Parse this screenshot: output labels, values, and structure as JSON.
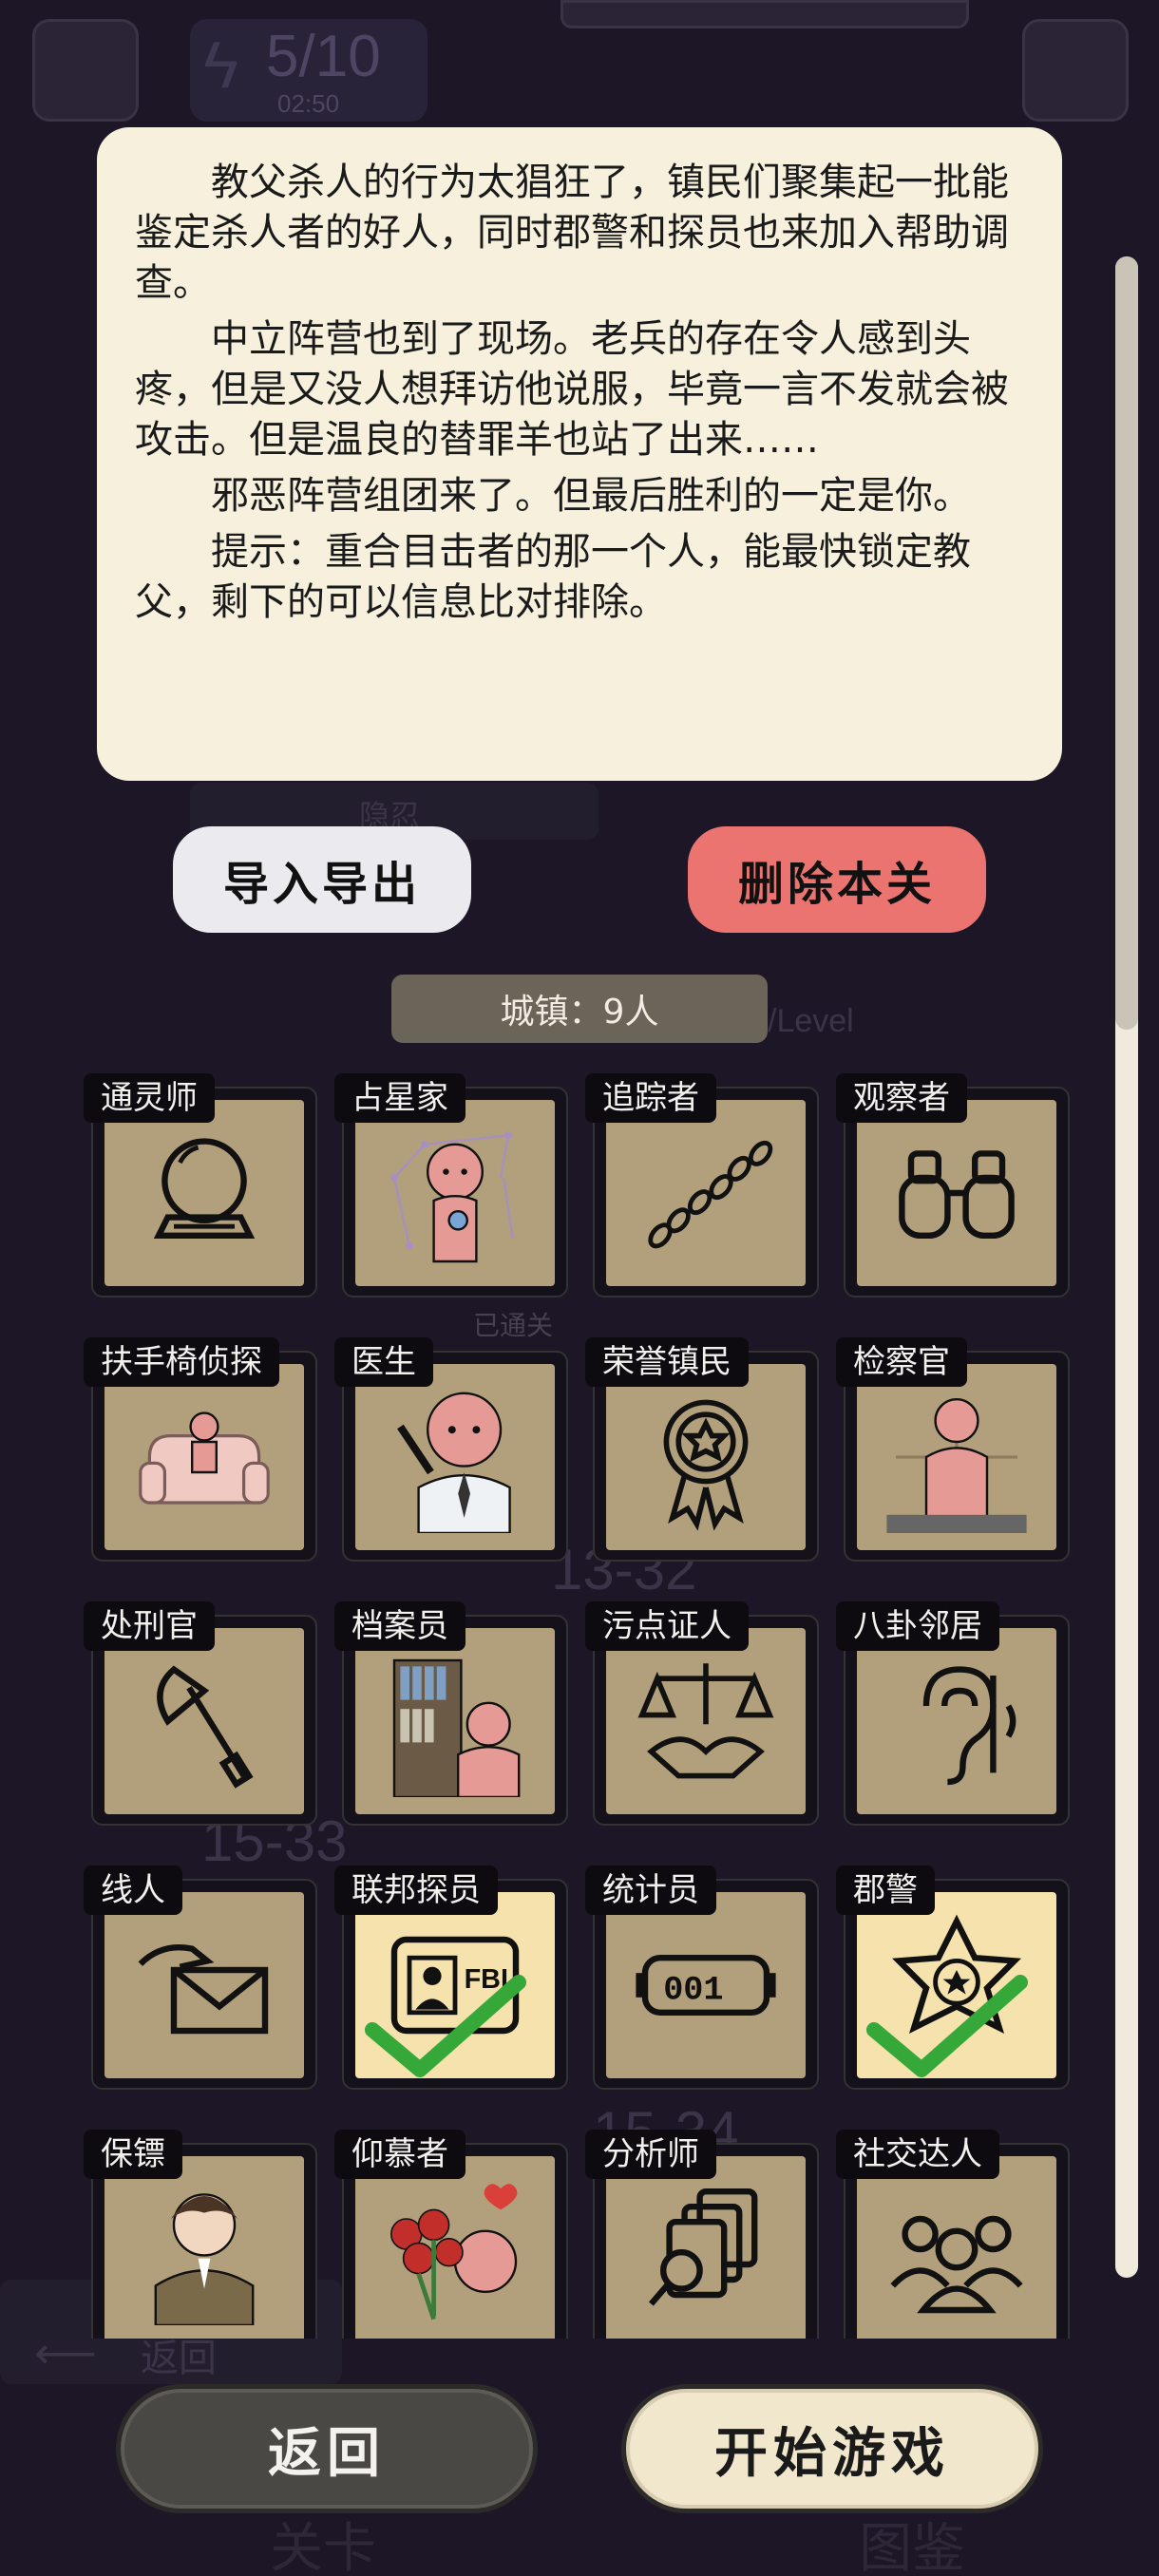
{
  "background": {
    "energy_value": "5/10",
    "energy_timer": "02:50",
    "faded_back_label": "返回",
    "faded_bottom_left": "关卡",
    "faded_bottom_right": "图鉴",
    "faded_hidden_label": "隐忍",
    "faded_level_label": "/Level",
    "faded_cleared_label": "已通关",
    "faded_row_1": "13-32",
    "faded_row_2": "15-33",
    "faded_row_3": "15-34"
  },
  "story": {
    "paragraphs": [
      "教父杀人的行为太猖狂了，镇民们聚集起一批能鉴定杀人者的好人，同时郡警和探员也来加入帮助调查。",
      "中立阵营也到了现场。老兵的存在令人感到头疼，但是又没人想拜访他说服，毕竟一言不发就会被攻击。但是温良的替罪羊也站了出来……",
      "邪恶阵营组团来了。但最后胜利的一定是你。",
      "提示：重合目击者的那一个人，能最快锁定教父，剩下的可以信息比对排除。"
    ]
  },
  "buttons": {
    "export": "导入导出",
    "delete": "删除本关",
    "back": "返回",
    "start": "开始游戏"
  },
  "town_label": "城镇：9人",
  "roles": [
    {
      "name": "通灵师",
      "icon": "crystal-ball-icon",
      "selected": false
    },
    {
      "name": "占星家",
      "icon": "astrologer-icon",
      "selected": false
    },
    {
      "name": "追踪者",
      "icon": "footprints-icon",
      "selected": false
    },
    {
      "name": "观察者",
      "icon": "binoculars-icon",
      "selected": false
    },
    {
      "name": "扶手椅侦探",
      "icon": "armchair-icon",
      "selected": false
    },
    {
      "name": "医生",
      "icon": "doctor-icon",
      "selected": false
    },
    {
      "name": "荣誉镇民",
      "icon": "medal-icon",
      "selected": false
    },
    {
      "name": "检察官",
      "icon": "prosecutor-icon",
      "selected": false
    },
    {
      "name": "处刑官",
      "icon": "axe-icon",
      "selected": false
    },
    {
      "name": "档案员",
      "icon": "bookshelf-icon",
      "selected": false
    },
    {
      "name": "污点证人",
      "icon": "scales-handshake-icon",
      "selected": false
    },
    {
      "name": "八卦邻居",
      "icon": "ear-icon",
      "selected": false
    },
    {
      "name": "线人",
      "icon": "envelope-icon",
      "selected": false
    },
    {
      "name": "联邦探员",
      "icon": "fbi-badge-icon",
      "selected": true
    },
    {
      "name": "统计员",
      "icon": "counter-icon",
      "selected": false
    },
    {
      "name": "郡警",
      "icon": "sheriff-star-icon",
      "selected": true
    },
    {
      "name": "保镖",
      "icon": "bodyguard-icon",
      "selected": false
    },
    {
      "name": "仰慕者",
      "icon": "roses-icon",
      "selected": false
    },
    {
      "name": "分析师",
      "icon": "documents-magnifier-icon",
      "selected": false
    },
    {
      "name": "社交达人",
      "icon": "people-icon",
      "selected": false
    }
  ],
  "fbi_text": "FBI",
  "counter_text": "001",
  "colors": {
    "background": "#1c1626",
    "panel": "#f6f0dc",
    "delete_button": "#ec7470",
    "card": "#b1a07b",
    "card_selected": "#f5e2ad",
    "check": "#36a83a"
  }
}
